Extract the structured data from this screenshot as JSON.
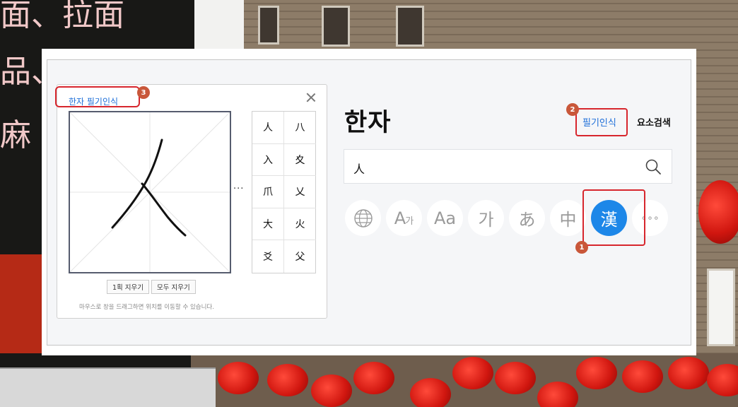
{
  "background": {
    "sign_text_1": "面、拉面",
    "sign_text_2": "品、",
    "sign_text_3": "麻"
  },
  "handwriting_popup": {
    "title": "한자 필기인식",
    "candidates": [
      "人",
      "八",
      "入",
      "夊",
      "爪",
      "乂",
      "大",
      "火",
      "爻",
      "父"
    ],
    "more_label": "···",
    "clear_one_stroke_label": "1획 지우기",
    "clear_all_label": "모두 지우기",
    "help_text": "마우스로 창을 드래그하면 위치를 이동할 수 있습니다."
  },
  "main": {
    "title": "한자",
    "tabs": {
      "handwriting": "필기인식",
      "element_search": "요소검색"
    },
    "search": {
      "value": "人"
    },
    "modes": [
      {
        "icon": "globe-icon",
        "label": ""
      },
      {
        "icon": "font-a-ga-icon",
        "label": "A",
        "sub": "가"
      },
      {
        "icon": "font-aa-icon",
        "label": "Aa"
      },
      {
        "icon": "hangul-icon",
        "label": "가"
      },
      {
        "icon": "hiragana-icon",
        "label": "あ"
      },
      {
        "icon": "chinese-icon",
        "label": "中"
      },
      {
        "icon": "hanja-icon",
        "label": "漢"
      },
      {
        "icon": "more-icon",
        "label": "∘∘∘"
      }
    ],
    "active_mode": "hanja-icon",
    "accent_color": "#1d87e8"
  },
  "annotations": {
    "marker_1": "1",
    "marker_2": "2",
    "marker_3": "3",
    "highlight_color": "#d7262d"
  }
}
